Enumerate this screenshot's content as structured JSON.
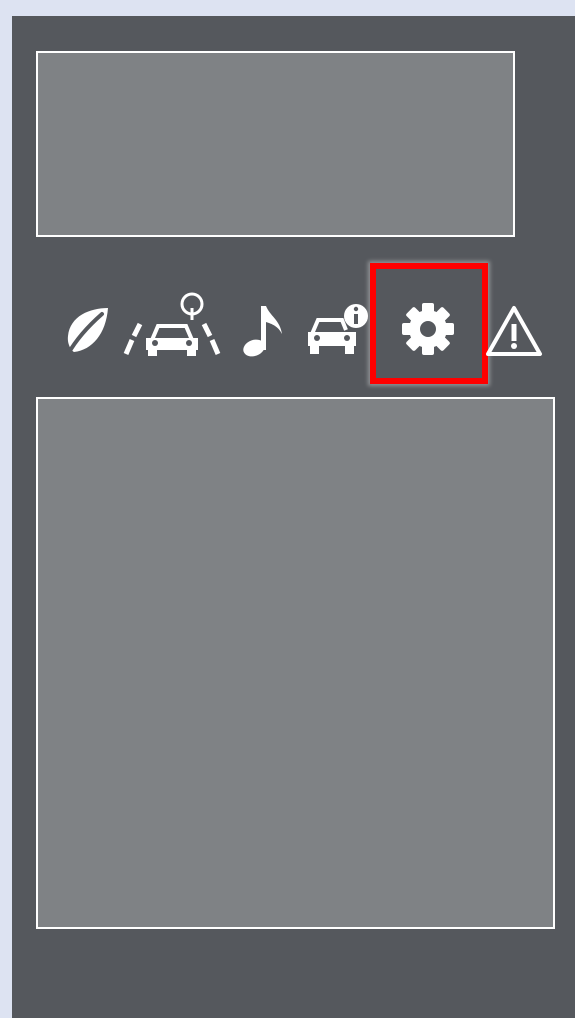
{
  "colors": {
    "page_background": "#dde3f2",
    "panel_background": "#55585d",
    "box_fill": "#7f8285",
    "icon_color": "#ffffff",
    "highlight": "#ff0000"
  },
  "icon_bar": {
    "items": [
      {
        "name": "eco-leaf-icon"
      },
      {
        "name": "lane-assist-car-icon"
      },
      {
        "name": "music-note-icon"
      },
      {
        "name": "vehicle-info-icon"
      },
      {
        "name": "settings-gear-icon",
        "selected": true
      },
      {
        "name": "warning-triangle-icon"
      }
    ]
  }
}
